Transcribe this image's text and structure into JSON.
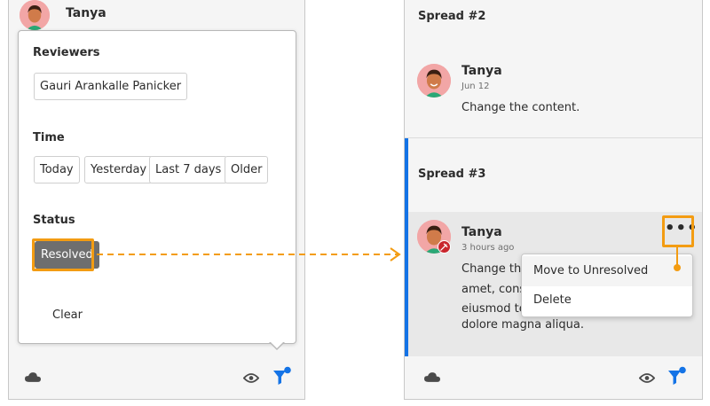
{
  "left_panel": {
    "top_comment": {
      "author": "Tanya"
    },
    "filter": {
      "reviewers_label": "Reviewers",
      "reviewers": [
        "Gauri Arankalle Panicker"
      ],
      "time_label": "Time",
      "time_options": [
        "Today",
        "Yesterday",
        "Last 7 days",
        "Older"
      ],
      "status_label": "Status",
      "status_selected": "Resolved",
      "clear_label": "Clear"
    },
    "bottom_bar": {
      "icons": [
        "cloud-icon",
        "eye-icon",
        "filter-icon"
      ]
    }
  },
  "right_panel": {
    "spread2": {
      "header": "Spread #2",
      "comment": {
        "author": "Tanya",
        "date": "Jun 12",
        "text": "Change the content."
      }
    },
    "spread3": {
      "header": "Spread #3",
      "comment": {
        "author": "Tanya",
        "time": "3 hours ago",
        "text_lines": [
          "Change the",
          "amet, conse",
          "eiusmod ter",
          "dolore magna aliqua."
        ]
      },
      "more_label": "•••",
      "menu_items": [
        "Move to Unresolved",
        "Delete"
      ]
    },
    "bottom_bar": {
      "icons": [
        "cloud-icon",
        "eye-icon",
        "filter-icon"
      ]
    }
  },
  "colors": {
    "accent_orange": "#f39c12",
    "accent_blue": "#1473e6",
    "badge_red": "#c9252d",
    "selected_chip": "#6e6e6e"
  }
}
